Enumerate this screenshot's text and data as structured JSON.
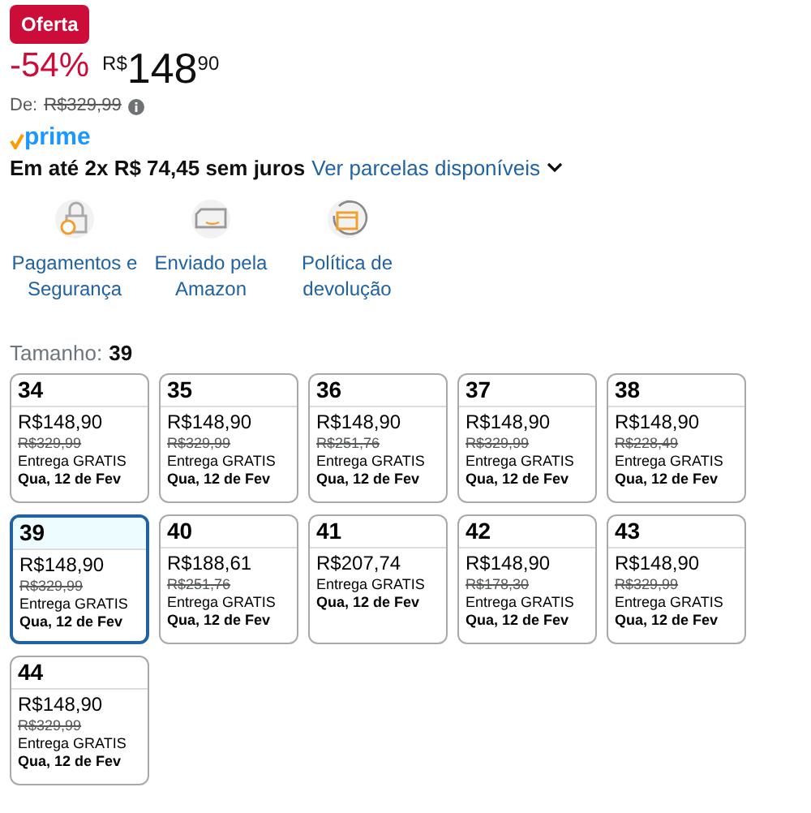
{
  "deal_badge": "Oferta",
  "price": {
    "discount": "-54%",
    "currency": "R$",
    "whole": "148",
    "cents": "90"
  },
  "list_price": {
    "label": "De:",
    "value": "R$329,99"
  },
  "prime": "prime",
  "installments": {
    "text": "Em até 2x R$ 74,45 sem juros",
    "link": "Ver parcelas disponíveis"
  },
  "features": [
    {
      "kind": "lock",
      "label": "Pagamentos e Segurança"
    },
    {
      "kind": "truck",
      "label": "Enviado pela Amazon"
    },
    {
      "kind": "return",
      "label": "Política de devolução"
    }
  ],
  "size_label": "Tamanho:",
  "size_value": "39",
  "sizes": [
    {
      "size": "34",
      "price": "R$148,90",
      "list_price": "R$329,99",
      "delivery": "Entrega GRATIS",
      "date": "Qua, 12 de Fev",
      "selected": false
    },
    {
      "size": "35",
      "price": "R$148,90",
      "list_price": "R$329,99",
      "delivery": "Entrega GRATIS",
      "date": "Qua, 12 de Fev",
      "selected": false
    },
    {
      "size": "36",
      "price": "R$148,90",
      "list_price": "R$251,76",
      "delivery": "Entrega GRATIS",
      "date": "Qua, 12 de Fev",
      "selected": false
    },
    {
      "size": "37",
      "price": "R$148,90",
      "list_price": "R$329,99",
      "delivery": "Entrega GRATIS",
      "date": "Qua, 12 de Fev",
      "selected": false
    },
    {
      "size": "38",
      "price": "R$148,90",
      "list_price": "R$228,49",
      "delivery": "Entrega GRATIS",
      "date": "Qua, 12 de Fev",
      "selected": false
    },
    {
      "size": "39",
      "price": "R$148,90",
      "list_price": "R$329,99",
      "delivery": "Entrega GRATIS",
      "date": "Qua, 12 de Fev",
      "selected": true
    },
    {
      "size": "40",
      "price": "R$188,61",
      "list_price": "R$251,76",
      "delivery": "Entrega GRATIS",
      "date": "Qua, 12 de Fev",
      "selected": false
    },
    {
      "size": "41",
      "price": "R$207,74",
      "delivery": "Entrega GRATIS",
      "date": "Qua, 12 de Fev",
      "selected": false
    },
    {
      "size": "42",
      "price": "R$148,90",
      "list_price": "R$178,30",
      "delivery": "Entrega GRATIS",
      "date": "Qua, 12 de Fev",
      "selected": false
    },
    {
      "size": "43",
      "price": "R$148,90",
      "list_price": "R$329,99",
      "delivery": "Entrega GRATIS",
      "date": "Qua, 12 de Fev",
      "selected": false
    },
    {
      "size": "44",
      "price": "R$148,90",
      "list_price": "R$329,99",
      "delivery": "Entrega GRATIS",
      "date": "Qua, 12 de Fev",
      "selected": false
    }
  ]
}
